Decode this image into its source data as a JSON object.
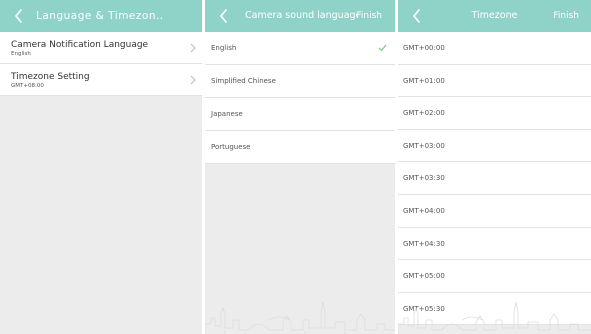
{
  "colors": {
    "header": "#8fd3c8",
    "background": "#ececec",
    "check": "#8ccf9a"
  },
  "panel_language_timezone": {
    "title": "Language & Timezon..",
    "rows": [
      {
        "title": "Camera Notification Language",
        "value": "English"
      },
      {
        "title": "Timezone Setting",
        "value": "GMT+08:00"
      }
    ]
  },
  "panel_camera_sound": {
    "title": "Camera sound language",
    "finish_label": "Finish",
    "options": [
      {
        "label": "English",
        "selected": true
      },
      {
        "label": "Simplified Chinese",
        "selected": false
      },
      {
        "label": "Japanese",
        "selected": false
      },
      {
        "label": "Portuguese",
        "selected": false
      }
    ]
  },
  "panel_timezone": {
    "title": "Timezone",
    "finish_label": "Finish",
    "options": [
      "GMT+00:00",
      "GMT+01:00",
      "GMT+02:00",
      "GMT+03:00",
      "GMT+03:30",
      "GMT+04:00",
      "GMT+04:30",
      "GMT+05:00",
      "GMT+05:30"
    ]
  },
  "icons": [
    "back-arrow-icon",
    "chevron-right-icon",
    "checkmark-icon",
    "city-skyline-watermark"
  ]
}
